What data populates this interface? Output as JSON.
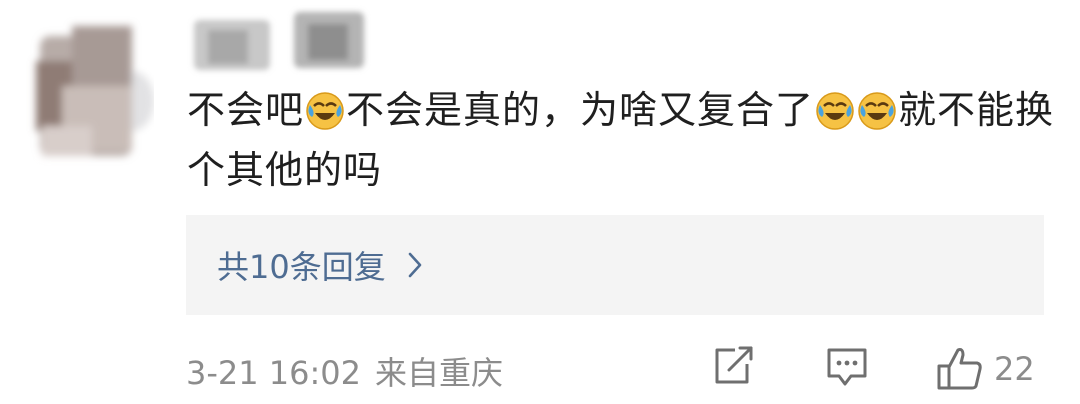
{
  "comment": {
    "segments": [
      {
        "type": "text",
        "value": "不会吧"
      },
      {
        "type": "emoji",
        "name": "laugh-cry-emoji"
      },
      {
        "type": "text",
        "value": "不会是真的，为啥又复合了"
      },
      {
        "type": "emoji",
        "name": "laugh-cry-emoji"
      },
      {
        "type": "emoji",
        "name": "laugh-cry-emoji"
      },
      {
        "type": "text",
        "value": "就不能换个其他的吗"
      }
    ]
  },
  "replies": {
    "label": "共10条回复"
  },
  "footer": {
    "time": "3-21 16:02",
    "location": "来自重庆",
    "like_count": "22"
  },
  "colors": {
    "link": "#4e6c92",
    "meta": "#8c8c8c",
    "reply_bg": "#f4f4f4",
    "emoji_yellow": "#f6c244",
    "emoji_tear": "#4aa3e0"
  }
}
